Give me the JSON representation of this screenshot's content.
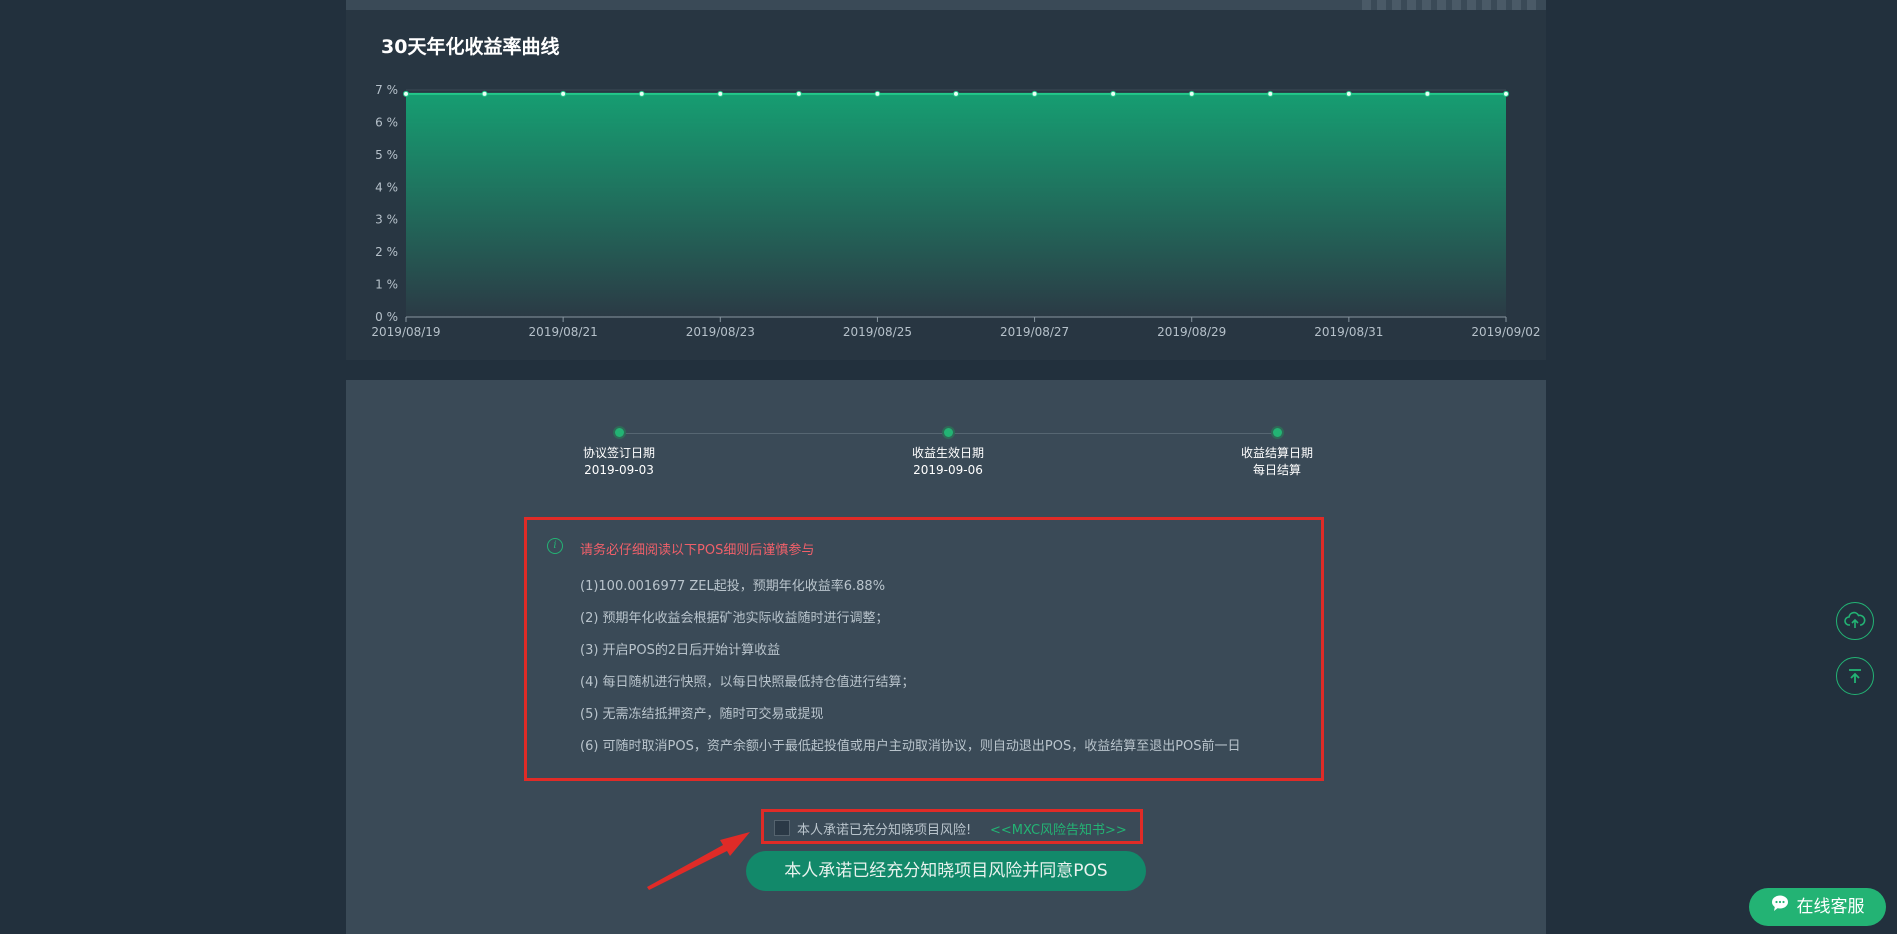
{
  "chart_data": {
    "type": "area",
    "title": "30天年化收益率曲线",
    "x": [
      "2019/08/19",
      "2019/08/20",
      "2019/08/21",
      "2019/08/22",
      "2019/08/23",
      "2019/08/24",
      "2019/08/25",
      "2019/08/26",
      "2019/08/27",
      "2019/08/28",
      "2019/08/29",
      "2019/08/30",
      "2019/08/31",
      "2019/09/01",
      "2019/09/02"
    ],
    "x_tick_labels": [
      "2019/08/19",
      "2019/08/21",
      "2019/08/23",
      "2019/08/25",
      "2019/08/27",
      "2019/08/29",
      "2019/08/31",
      "2019/09/02"
    ],
    "y_tick_labels": [
      "0 %",
      "1 %",
      "2 %",
      "3 %",
      "4 %",
      "5 %",
      "6 %",
      "7 %"
    ],
    "series": [
      {
        "values": [
          6.88,
          6.88,
          6.88,
          6.88,
          6.88,
          6.88,
          6.88,
          6.88,
          6.88,
          6.88,
          6.88,
          6.88,
          6.88,
          6.88,
          6.88
        ]
      }
    ],
    "ylim": [
      0,
      7
    ],
    "grid": true,
    "colors": {
      "line": "#23c88a",
      "fill_top": "#15a374",
      "fill_bottom": "#2b3a45"
    }
  },
  "steps": [
    {
      "label": "协议签订日期",
      "value": "2019-09-03"
    },
    {
      "label": "收益生效日期",
      "value": "2019-09-06"
    },
    {
      "label": "收益结算日期",
      "value": "每日结算"
    }
  ],
  "rules": {
    "title": "请务必仔细阅读以下POS细则后谨慎参与",
    "items": [
      "(1)100.0016977 ZEL起投，预期年化收益率6.88%",
      "(2) 预期年化收益会根据矿池实际收益随时进行调整；",
      "(3) 开启POS的2日后开始计算收益",
      "(4) 每日随机进行快照，以每日快照最低持仓值进行结算；",
      "(5) 无需冻结抵押资产，随时可交易或提现",
      "(6) 可随时取消POS，资产余额小于最低起投值或用户主动取消协议，则自动退出POS，收益结算至退出POS前一日"
    ]
  },
  "agreement": {
    "text": "本人承诺已充分知晓项目风险!",
    "link": "<<MXC风险告知书>>",
    "checked": false
  },
  "submit_label": "本人承诺已经充分知晓项目风险并同意POS",
  "service_label": "在线客服",
  "icons": {
    "cloud": "cloud-upload-icon",
    "top": "back-to-top-icon",
    "info": "info-icon",
    "chat": "chat-icon"
  },
  "accent_color": "#23b374"
}
